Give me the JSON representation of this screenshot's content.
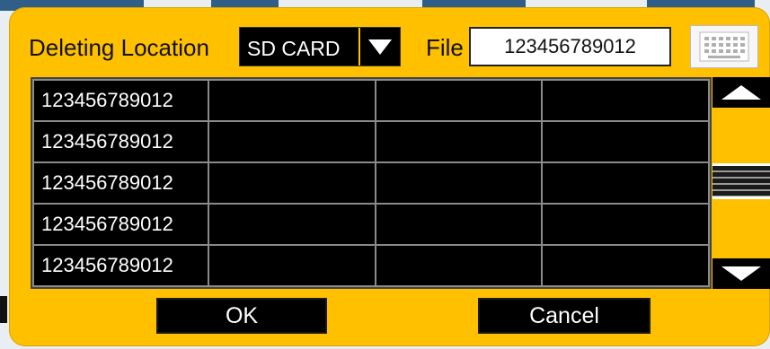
{
  "dialog": {
    "location_label": "Deleting Location",
    "location_value": "SD CARD",
    "file_label": "File",
    "file_value": "123456789012"
  },
  "table": {
    "rows": [
      [
        "123456789012",
        "",
        "",
        ""
      ],
      [
        "123456789012",
        "",
        "",
        ""
      ],
      [
        "123456789012",
        "",
        "",
        ""
      ],
      [
        "123456789012",
        "",
        "",
        ""
      ],
      [
        "123456789012",
        "",
        "",
        ""
      ]
    ]
  },
  "buttons": {
    "ok": "OK",
    "cancel": "Cancel"
  },
  "icons": {
    "dropdown": "chevron-down-icon",
    "keyboard": "keyboard-icon",
    "scroll_up": "arrow-up-icon",
    "scroll_down": "arrow-down-icon"
  },
  "colors": {
    "dialog_bg": "#ffc000",
    "panel_bg": "#000000",
    "text_light": "#ffffff",
    "text_dark": "#111111"
  }
}
